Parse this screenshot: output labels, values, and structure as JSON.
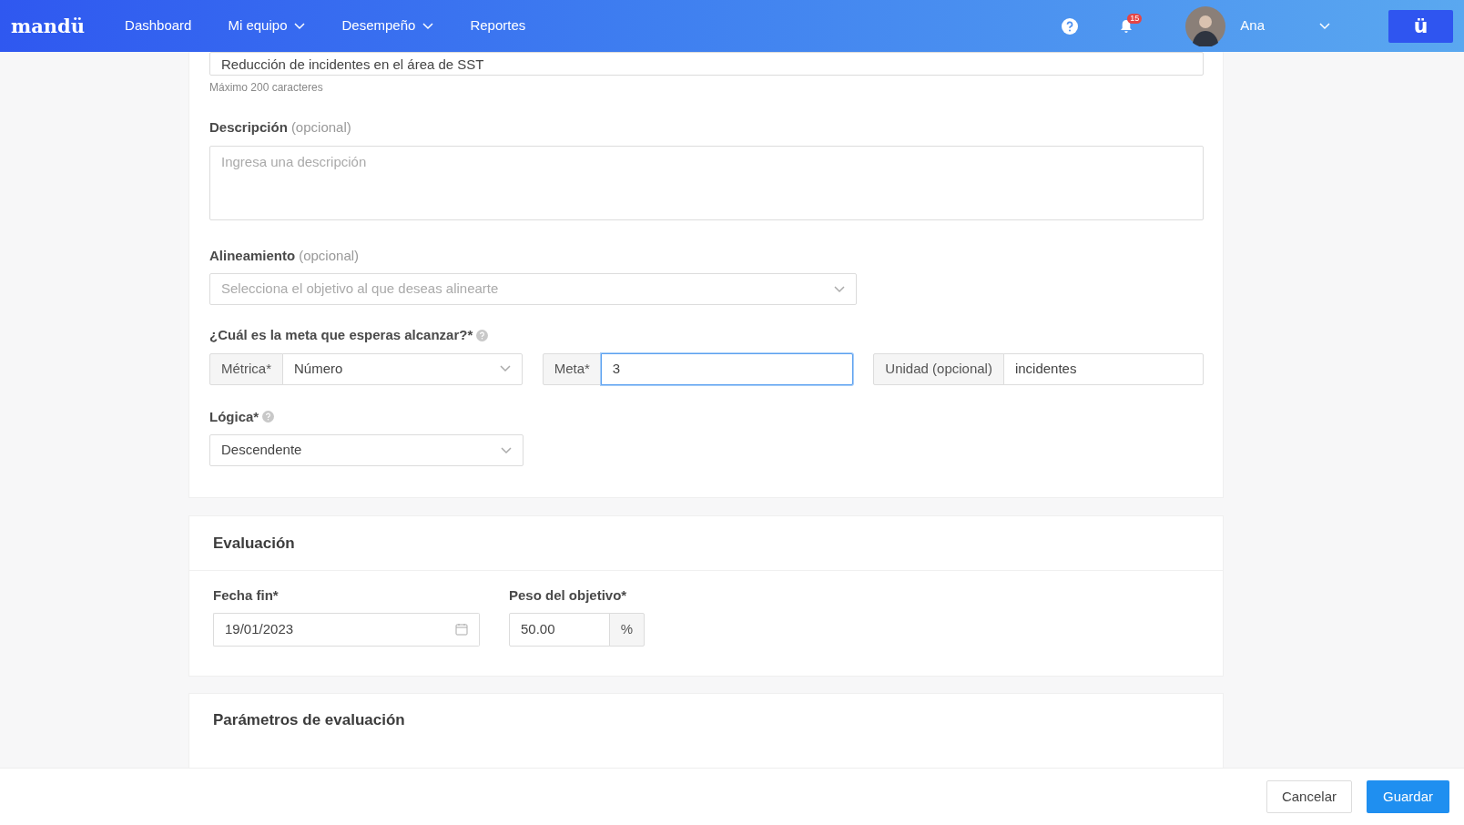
{
  "navbar": {
    "logo": "mandü",
    "items": [
      {
        "label": "Dashboard",
        "has_menu": false
      },
      {
        "label": "Mi equipo",
        "has_menu": true
      },
      {
        "label": "Desempeño",
        "has_menu": true
      },
      {
        "label": "Reportes",
        "has_menu": false
      }
    ],
    "notifications_badge": "15",
    "user": {
      "name": "Ana"
    },
    "app_button": "ü"
  },
  "objective": {
    "title_value": "Reducción de incidentes en el área de SST",
    "title_hint": "Máximo 200 caracteres",
    "description": {
      "label": "Descripción",
      "optional": "(opcional)",
      "placeholder": "Ingresa una descripción"
    },
    "alignment": {
      "label": "Alineamiento",
      "optional": "(opcional)",
      "placeholder": "Selecciona el objetivo al que deseas alinearte"
    },
    "goal": {
      "label": "¿Cuál es la meta que esperas alcanzar?*",
      "metric": {
        "label": "Métrica*",
        "value": "Número"
      },
      "target": {
        "label": "Meta*",
        "value": "3",
        "focused": true
      },
      "unit": {
        "label": "Unidad (opcional)",
        "value": "incidentes"
      }
    },
    "logic": {
      "label": "Lógica*",
      "value": "Descendente"
    }
  },
  "evaluation": {
    "title": "Evaluación",
    "end_date": {
      "label": "Fecha fin*",
      "value": "19/01/2023"
    },
    "weight": {
      "label": "Peso del objetivo*",
      "value": "50.00",
      "suffix": "%"
    }
  },
  "parameters": {
    "title": "Parámetros de evaluación"
  },
  "footer": {
    "buttons": [
      {
        "label": "Cancelar",
        "kind": "secondary"
      },
      {
        "label": "Guardar",
        "kind": "primary"
      }
    ]
  }
}
